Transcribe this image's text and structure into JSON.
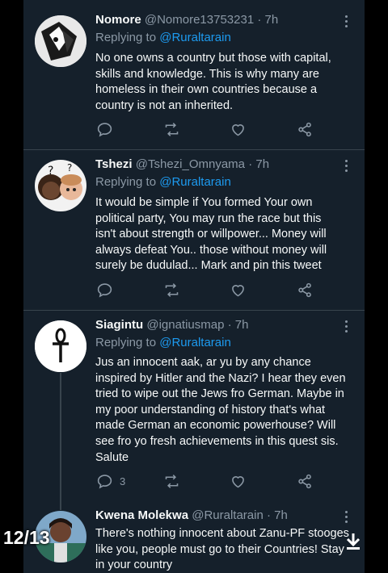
{
  "tweets": [
    {
      "name": "Nomore",
      "handle": "@Nomore13753231",
      "sep": "·",
      "time": "7h",
      "replying_label": "Replying to",
      "replying_to": "@Ruraltarain",
      "text": "No one owns a country but those with capital,\nskills and knowledge. This is why many are\nhomeless in their own countries because a\ncountry is not an inherited.",
      "reply_count": ""
    },
    {
      "name": "Tshezi",
      "handle": "@Tshezi_Omnyama",
      "sep": "·",
      "time": "7h",
      "replying_label": "Replying to",
      "replying_to": "@Ruraltarain",
      "text": "It would be simple if You formed Your own\npolitical party, You may run the race but this\nisn't about strength or willpower... Money will\nalways defeat You.. those without money will\nsurely be dudulad... Mark and pin this tweet",
      "reply_count": ""
    },
    {
      "name": "Siagintu",
      "handle": "@ignatiusmap",
      "sep": "·",
      "time": "7h",
      "replying_label": "Replying to",
      "replying_to": "@Ruraltarain",
      "text": "Jus an innocent aak, ar yu by any chance\ninspired by Hitler and the Nazi? I hear they even\ntried to wipe out the Jews fro German. Maybe in\nmy poor understanding of history that's what\nmade German an economic powerhouse? Will\nsee fro yo fresh achievements in this quest sis.\nSalute",
      "reply_count": "3"
    },
    {
      "name": "Kwena Molekwa",
      "handle": "@Ruraltarain",
      "sep": "·",
      "time": "7h",
      "text": "There's nothing innocent about Zanu-PF stooges\nlike you, people must go to their Countries! Stay\nin your country"
    }
  ],
  "overlay": {
    "page_indicator": "12/13",
    "download_icon": "download-icon"
  },
  "colors": {
    "background": "#15202b",
    "text": "#f7f9f9",
    "muted": "#8b98a5",
    "link": "#1d9bf0",
    "divider": "#38444d"
  },
  "icons": [
    "reply-icon",
    "retweet-icon",
    "like-icon",
    "share-icon",
    "more-icon"
  ]
}
